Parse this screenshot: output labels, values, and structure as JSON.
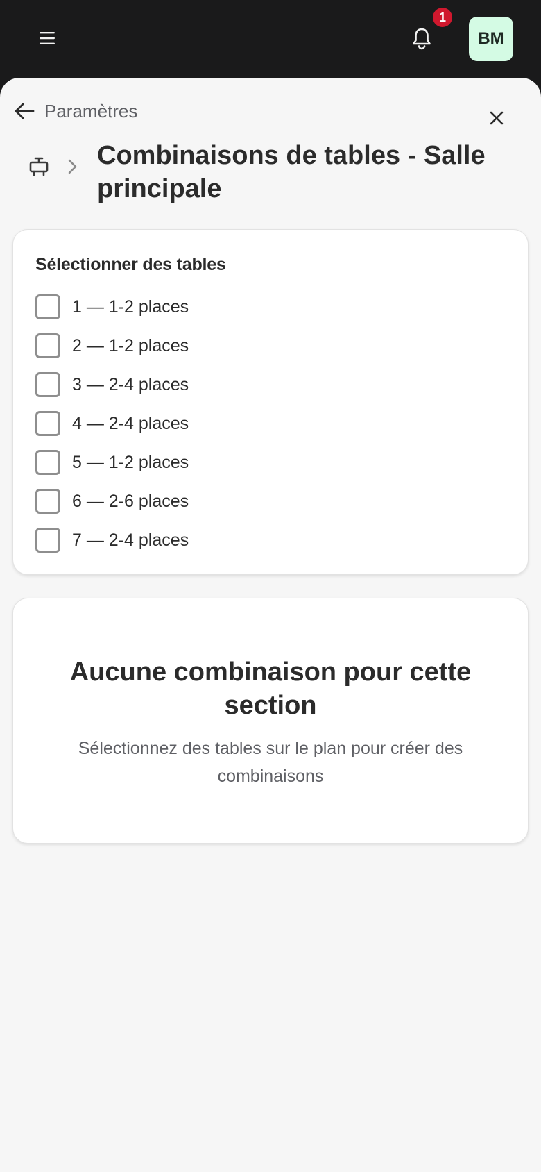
{
  "header": {
    "notification_count": "1",
    "avatar_initials": "BM"
  },
  "nav": {
    "back_label": "Paramètres"
  },
  "page": {
    "title": "Combinaisons de tables - Salle principale"
  },
  "selection": {
    "heading": "Sélectionner des tables",
    "tables": [
      {
        "label": "1 — 1-2 places",
        "checked": false
      },
      {
        "label": "2 — 1-2 places",
        "checked": false
      },
      {
        "label": "3 — 2-4 places",
        "checked": false
      },
      {
        "label": "4 — 2-4 places",
        "checked": false
      },
      {
        "label": "5 — 1-2 places",
        "checked": false
      },
      {
        "label": "6 — 2-6 places",
        "checked": false
      },
      {
        "label": "7 — 2-4 places",
        "checked": false
      }
    ]
  },
  "empty_state": {
    "title": "Aucune combinaison pour cette section",
    "subtitle": "Sélectionnez des tables sur le plan pour créer des combinaisons"
  },
  "colors": {
    "topbar": "#1a1a1b",
    "badge": "#d0182e",
    "avatar_bg": "#d4fbe4",
    "sheet_bg": "#f6f6f6"
  },
  "icons": {
    "menu": "hamburger-menu-icon",
    "bell": "bell-icon",
    "back": "arrow-left-icon",
    "close": "close-icon",
    "section": "table-icon",
    "chevron": "chevron-right-icon"
  }
}
